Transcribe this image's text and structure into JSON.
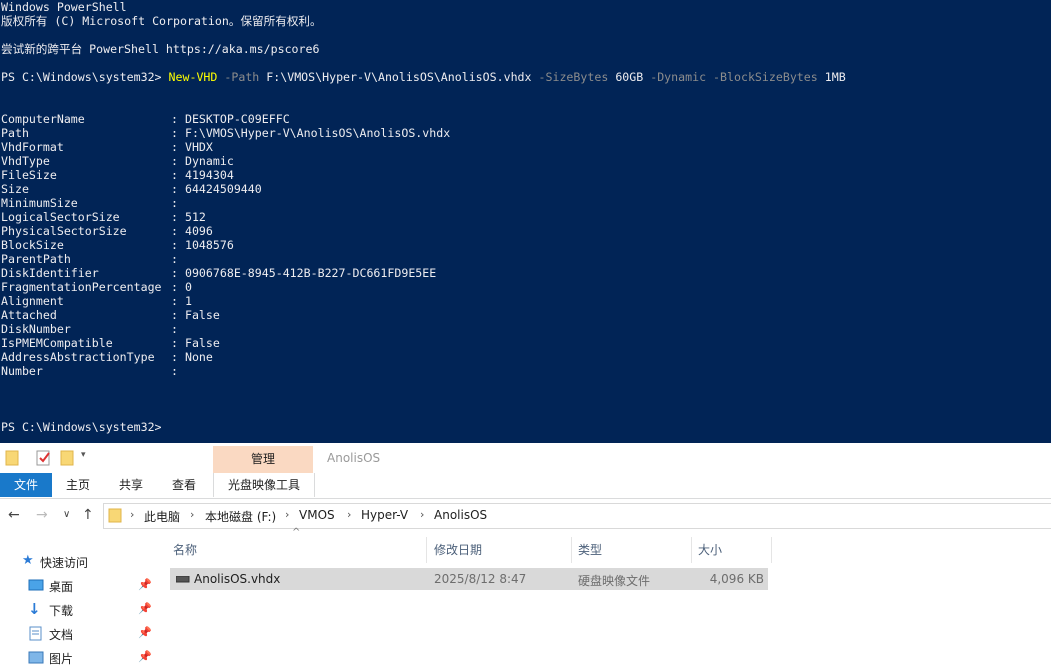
{
  "console": {
    "header1": "Windows PowerShell",
    "header2": "版权所有 (C) Microsoft Corporation。保留所有权利。",
    "header3": "尝试新的跨平台 PowerShell https://aka.ms/pscore6",
    "prompt": "PS C:\\Windows\\system32> ",
    "cmd_name": "New-VHD",
    "p_path": "-Path",
    "v_path": "F:\\VMOS\\Hyper-V\\AnolisOS\\AnolisOS.vhdx",
    "p_size": "-SizeBytes",
    "v_size": "60GB",
    "p_dynamic": "-Dynamic",
    "p_block": "-BlockSizeBytes",
    "v_block": "1MB",
    "props": [
      {
        "name": "ComputerName",
        "value": "DESKTOP-C09EFFC"
      },
      {
        "name": "Path",
        "value": "F:\\VMOS\\Hyper-V\\AnolisOS\\AnolisOS.vhdx"
      },
      {
        "name": "VhdFormat",
        "value": "VHDX"
      },
      {
        "name": "VhdType",
        "value": "Dynamic"
      },
      {
        "name": "FileSize",
        "value": "4194304"
      },
      {
        "name": "Size",
        "value": "64424509440"
      },
      {
        "name": "MinimumSize",
        "value": ""
      },
      {
        "name": "LogicalSectorSize",
        "value": "512"
      },
      {
        "name": "PhysicalSectorSize",
        "value": "4096"
      },
      {
        "name": "BlockSize",
        "value": "1048576"
      },
      {
        "name": "ParentPath",
        "value": ""
      },
      {
        "name": "DiskIdentifier",
        "value": "0906768E-8945-412B-B227-DC661FD9E5EE"
      },
      {
        "name": "FragmentationPercentage",
        "value": "0"
      },
      {
        "name": "Alignment",
        "value": "1"
      },
      {
        "name": "Attached",
        "value": "False"
      },
      {
        "name": "DiskNumber",
        "value": ""
      },
      {
        "name": "IsPMEMCompatible",
        "value": "False"
      },
      {
        "name": "AddressAbstractionType",
        "value": "None"
      },
      {
        "name": "Number",
        "value": ""
      }
    ],
    "final_prompt": "PS C:\\Windows\\system32>"
  },
  "explorer": {
    "context_header": "管理",
    "window_title": "AnolisOS",
    "tabs": {
      "file": "文件",
      "home": "主页",
      "share": "共享",
      "view": "查看",
      "context": "光盘映像工具"
    },
    "breadcrumb": [
      "此电脑",
      "本地磁盘 (F:)",
      "VMOS",
      "Hyper-V",
      "AnolisOS"
    ],
    "sidebar": [
      "快速访问",
      "桌面",
      "下载",
      "文档",
      "图片"
    ],
    "columns": {
      "name": "名称",
      "date": "修改日期",
      "type": "类型",
      "size": "大小"
    },
    "files": [
      {
        "name": "AnolisOS.vhdx",
        "date": "2025/8/12 8:47",
        "type": "硬盘映像文件",
        "size": "4,096 KB"
      }
    ],
    "colors": {
      "console_bg": "#012456",
      "cmd": "#ffff00",
      "param": "#8c8c8c",
      "file_tab": "#1979ca",
      "context_tab": "#fad9c2"
    }
  }
}
